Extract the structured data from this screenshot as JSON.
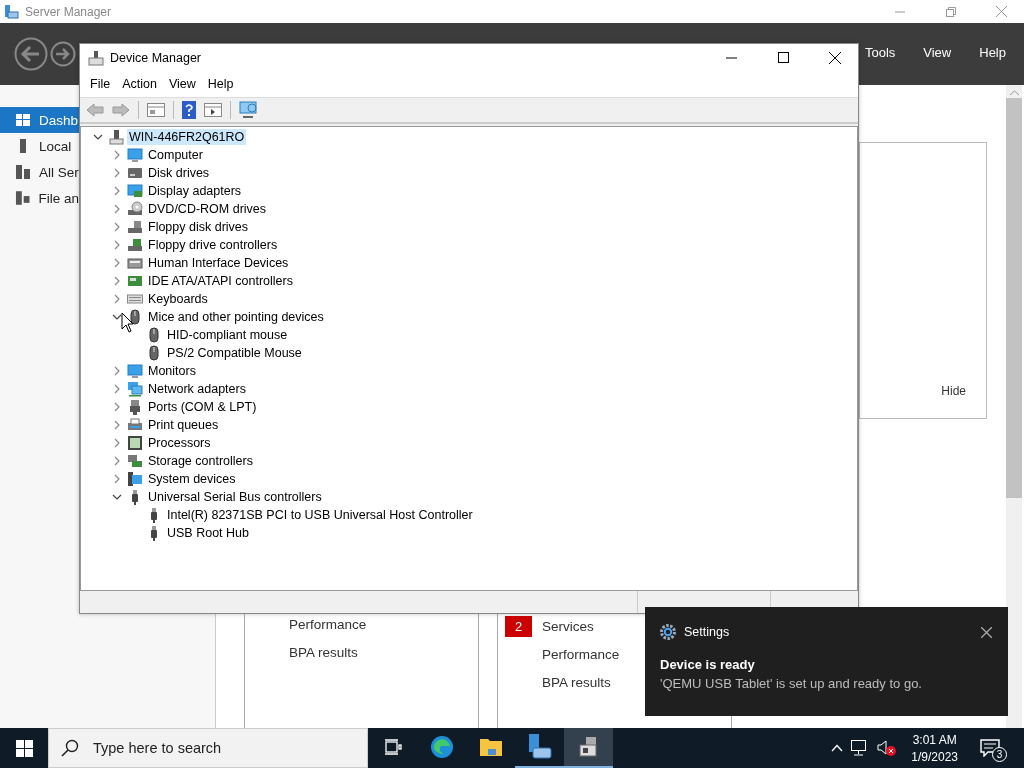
{
  "server_manager": {
    "title": "Server Manager",
    "menu": [
      "Tools",
      "View",
      "Help"
    ],
    "sidebar": [
      {
        "label": "Dashb",
        "selected": true
      },
      {
        "label": "Local",
        "selected": false
      },
      {
        "label": "All Ser",
        "selected": false
      },
      {
        "label": "File an",
        "selected": false
      }
    ],
    "hide_link": "Hide",
    "tiles": [
      {
        "items": [
          {
            "label": "Performance"
          },
          {
            "label": "BPA results"
          }
        ]
      },
      {
        "items": [
          {
            "label": "Services",
            "count": "2"
          },
          {
            "label": "Performance"
          },
          {
            "label": "BPA results"
          }
        ]
      }
    ]
  },
  "device_manager": {
    "title": "Device Manager",
    "menu": [
      "File",
      "Action",
      "View",
      "Help"
    ],
    "tree": {
      "label": "WIN-446FR2Q61RO",
      "expanded": true,
      "selected": true,
      "children": [
        {
          "label": "Computer",
          "expanded": false
        },
        {
          "label": "Disk drives",
          "expanded": false
        },
        {
          "label": "Display adapters",
          "expanded": false
        },
        {
          "label": "DVD/CD-ROM drives",
          "expanded": false
        },
        {
          "label": "Floppy disk drives",
          "expanded": false
        },
        {
          "label": "Floppy drive controllers",
          "expanded": false
        },
        {
          "label": "Human Interface Devices",
          "expanded": false
        },
        {
          "label": "IDE ATA/ATAPI controllers",
          "expanded": false
        },
        {
          "label": "Keyboards",
          "expanded": false
        },
        {
          "label": "Mice and other pointing devices",
          "expanded": true,
          "children": [
            {
              "label": "HID-compliant mouse"
            },
            {
              "label": "PS/2 Compatible Mouse"
            }
          ]
        },
        {
          "label": "Monitors",
          "expanded": false
        },
        {
          "label": "Network adapters",
          "expanded": false
        },
        {
          "label": "Ports (COM & LPT)",
          "expanded": false
        },
        {
          "label": "Print queues",
          "expanded": false
        },
        {
          "label": "Processors",
          "expanded": false
        },
        {
          "label": "Storage controllers",
          "expanded": false
        },
        {
          "label": "System devices",
          "expanded": false
        },
        {
          "label": "Universal Serial Bus controllers",
          "expanded": true,
          "children": [
            {
              "label": "Intel(R) 82371SB PCI to USB Universal Host Controller"
            },
            {
              "label": "USB Root Hub"
            }
          ]
        }
      ]
    }
  },
  "toast": {
    "app": "Settings",
    "title": "Device is ready",
    "message": "'QEMU USB Tablet' is set up and ready to go."
  },
  "taskbar": {
    "search": {
      "placeholder": "Type here to search"
    },
    "apps": [
      {
        "running": false,
        "selected": false
      },
      {
        "running": false,
        "selected": false
      },
      {
        "running": false,
        "selected": false
      },
      {
        "running": true,
        "selected": false
      },
      {
        "running": true,
        "selected": true
      }
    ],
    "volume_muted": true,
    "time": "3:01 AM",
    "date": "1/9/2023",
    "notifications": "3"
  }
}
